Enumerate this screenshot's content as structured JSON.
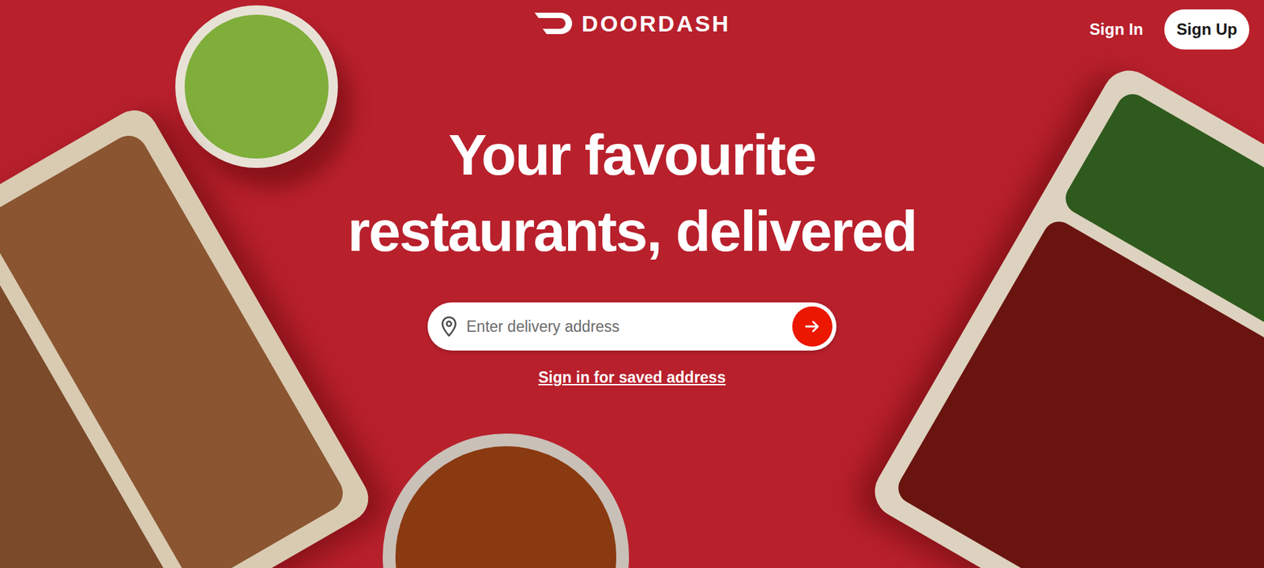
{
  "header": {
    "logo": "DOORDASH",
    "sign_in": "Sign In",
    "sign_up": "Sign Up"
  },
  "hero": {
    "headline_lines": [
      "Your favourite",
      "restaurants, delivered"
    ]
  },
  "search": {
    "placeholder": "Enter delivery address"
  },
  "saved_address_link": "Sign in for saved address"
}
